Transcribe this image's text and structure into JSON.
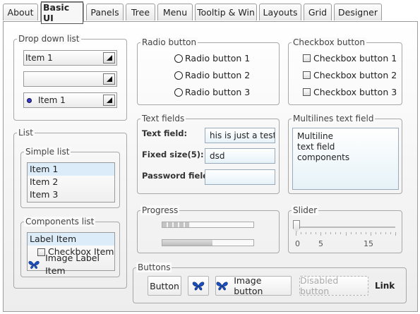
{
  "tabs": [
    {
      "label": "About",
      "active": false
    },
    {
      "label": "Basic UI",
      "active": true
    },
    {
      "label": "Panels",
      "active": false
    },
    {
      "label": "Tree",
      "active": false
    },
    {
      "label": "Menu",
      "active": false
    },
    {
      "label": "Tooltip & Win",
      "active": false
    },
    {
      "label": "Layouts",
      "active": false
    },
    {
      "label": "Grid",
      "active": false
    },
    {
      "label": "Designer",
      "active": false
    }
  ],
  "dropdown": {
    "title": "Drop down list",
    "combo1_value": "Item 1",
    "combo2_value": "",
    "combo3_value": "Item 1"
  },
  "list": {
    "title": "List",
    "simple": {
      "title": "Simple list",
      "items": [
        "Item 1",
        "Item 2",
        "Item 3"
      ]
    },
    "components": {
      "title": "Components list",
      "label_item": "Label Item",
      "checkbox_item": "Checkbox Item",
      "image_item": "Image Label Item"
    }
  },
  "radio": {
    "title": "Radio button",
    "items": [
      "Radio button 1",
      "Radio button 2",
      "Radio button 3"
    ]
  },
  "checkbox": {
    "title": "Checkbox button",
    "items": [
      "Checkbox button 1",
      "Checkbox button 2",
      "Checkbox button 3"
    ]
  },
  "textfields": {
    "title": "Text fields",
    "text_label": "Text field:",
    "text_value": "his is just a test.",
    "fixed_label": "Fixed size(5):",
    "fixed_value": "dsd",
    "password_label": "Password field:",
    "password_value": ""
  },
  "multiline": {
    "title": "Multilines text field",
    "lines": [
      "Multiline",
      "text field",
      "components"
    ]
  },
  "progress": {
    "title": "Progress",
    "bar1_fraction": 0.3,
    "bar2_fraction": 0.55
  },
  "slider": {
    "title": "Slider",
    "value": 0,
    "min": 0,
    "max": 20,
    "tick_labels": [
      "0",
      "5",
      "15"
    ]
  },
  "buttons": {
    "title": "Buttons",
    "button": "Button",
    "image_button": "Image button",
    "disabled_button": "Disabled button",
    "link": "Link"
  },
  "colors": {
    "selection": "#dcecf8",
    "field_bg": "#e6f2f8",
    "butterfly": "#1a4fc0"
  },
  "icons": {
    "butterfly": "butterfly-icon"
  }
}
